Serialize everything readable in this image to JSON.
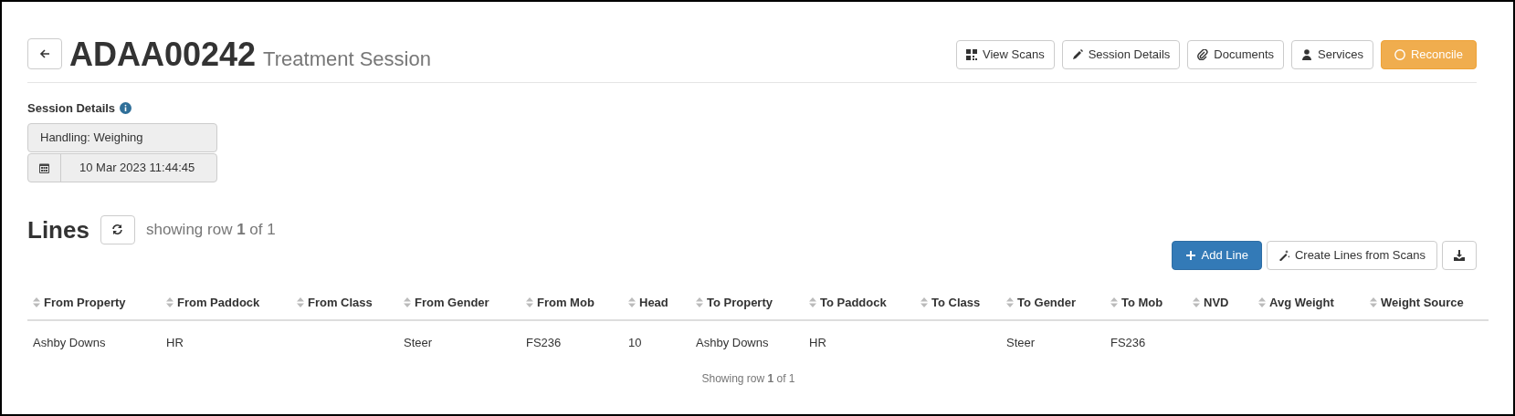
{
  "header": {
    "code": "ADAA00242",
    "subtitle": "Treatment Session"
  },
  "actions": [
    {
      "kind": "scans",
      "label": "View Scans"
    },
    {
      "kind": "pencil",
      "label": "Session Details"
    },
    {
      "kind": "clip",
      "label": "Documents"
    },
    {
      "kind": "person",
      "label": "Services"
    },
    {
      "kind": "reconcile",
      "label": "Reconcile"
    }
  ],
  "session_details": {
    "label": "Session Details",
    "type": "Handling: Weighing",
    "date": "10 Mar 2023 11:44:45"
  },
  "lines": {
    "title": "Lines",
    "summary": "showing row **1** of 1"
  },
  "toolbar": [
    {
      "kind": "add",
      "label": "Add Line"
    },
    {
      "kind": "wand",
      "label": "Create Lines from Scans"
    },
    {
      "kind": "download"
    }
  ],
  "table": {
    "columns": [
      "From Property",
      "From Paddock",
      "From Class",
      "From Gender",
      "From Mob",
      "Head",
      "To Property",
      "To Paddock",
      "To Class",
      "To Gender",
      "To Mob",
      "NVD",
      "Avg Weight",
      "Weight Source"
    ],
    "rows": [
      [
        "Ashby Downs",
        "HR",
        null,
        "Steer",
        "FS236",
        "10",
        "Ashby Downs",
        "HR",
        null,
        "Steer",
        "FS236",
        null,
        null,
        null
      ]
    ],
    "footer": "Showing row **1** of 1"
  }
}
